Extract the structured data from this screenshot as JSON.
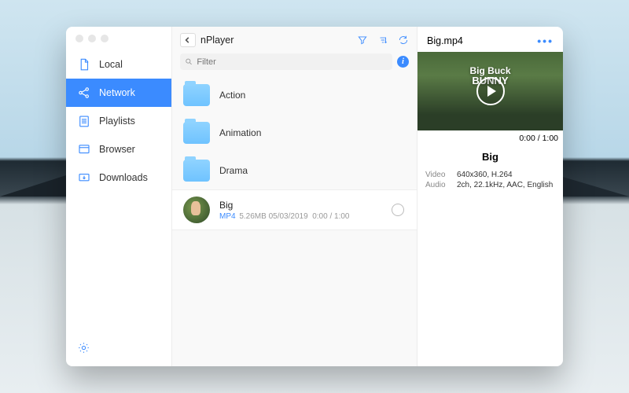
{
  "sidebar": {
    "items": [
      {
        "label": "Local",
        "icon": "document-icon"
      },
      {
        "label": "Network",
        "icon": "share-icon"
      },
      {
        "label": "Playlists",
        "icon": "list-doc-icon"
      },
      {
        "label": "Browser",
        "icon": "browser-icon"
      },
      {
        "label": "Downloads",
        "icon": "download-icon"
      }
    ],
    "active_index": 1
  },
  "browser": {
    "breadcrumb": "nPlayer",
    "filter_placeholder": "Filter",
    "folders": [
      {
        "name": "Action"
      },
      {
        "name": "Animation"
      },
      {
        "name": "Drama"
      }
    ],
    "files": [
      {
        "name": "Big",
        "format": "MP4",
        "size": "5.26MB",
        "date": "05/03/2019",
        "duration": "0:00 / 1:00"
      }
    ]
  },
  "detail": {
    "filename": "Big.mp4",
    "overlay_text_1": "Big Buck",
    "overlay_text_2": "BUNNY",
    "time": "0:00 / 1:00",
    "title": "Big",
    "video_label": "Video",
    "video_spec": "640x360, H.264",
    "audio_label": "Audio",
    "audio_spec": "2ch, 22.1kHz, AAC, English"
  }
}
